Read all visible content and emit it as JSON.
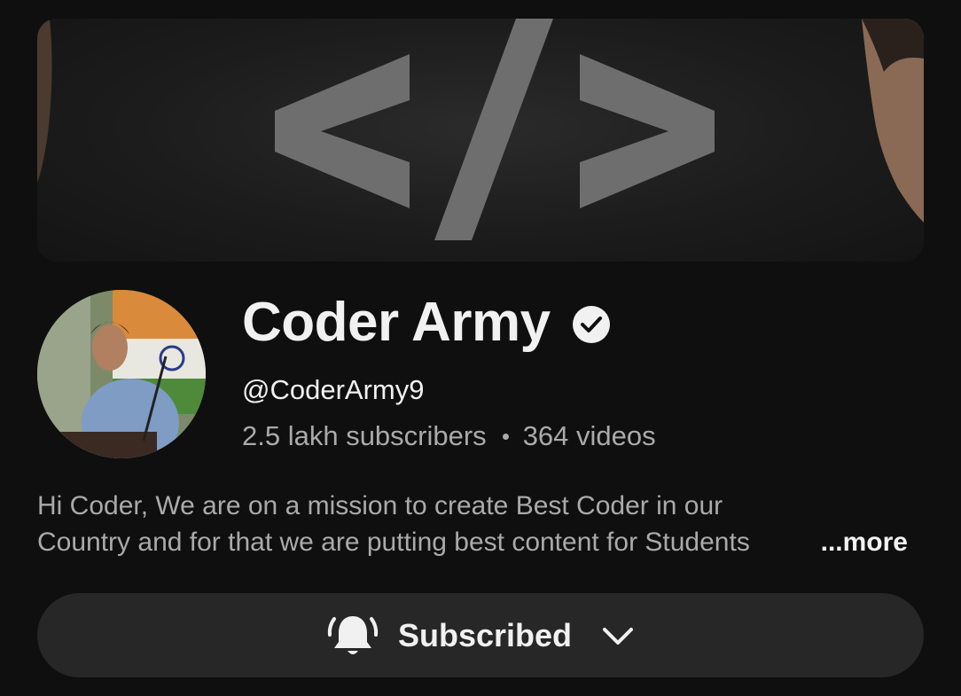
{
  "channel": {
    "name": "Coder Army",
    "handle": "@CoderArmy9",
    "subscribers": "2.5 lakh subscribers",
    "videos": "364 videos",
    "verified_icon": "verified-check-icon"
  },
  "banner": {
    "logo_text": "</>",
    "background_color": "#1c1c1c",
    "logo_color": "#6e6e6e"
  },
  "description": {
    "line1": "Hi Coder, We are on a mission to create Best Coder in our",
    "line2": "Country and for that we are putting best content for Students",
    "more_label": "...more"
  },
  "subscribe_button": {
    "label": "Subscribed",
    "bell_icon": "notification-bell-ringing-icon",
    "dropdown_icon": "chevron-down-icon"
  },
  "colors": {
    "background": "#0f0f0f",
    "primary_text": "#f1f1f1",
    "secondary_text": "#aaaaaa",
    "button_background": "#272727"
  }
}
